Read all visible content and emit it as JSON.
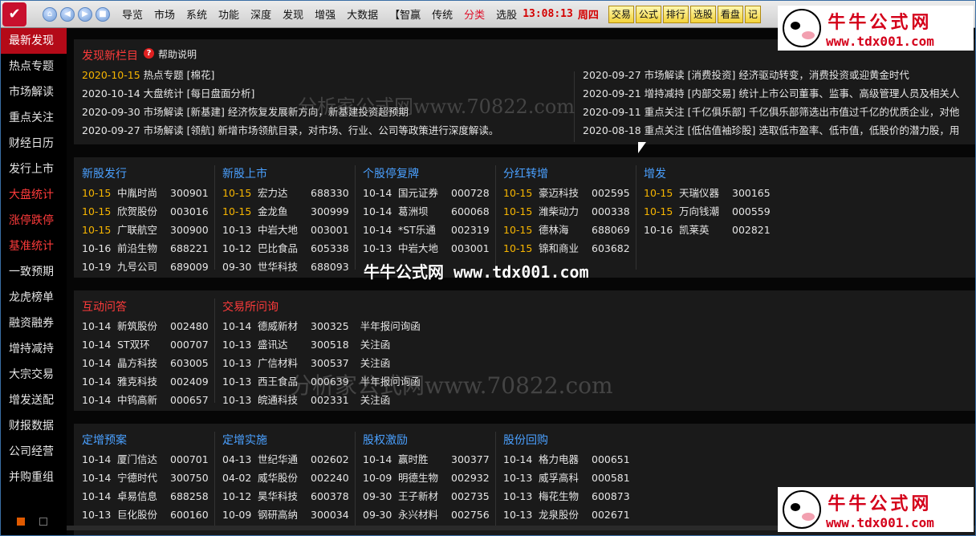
{
  "topbar": {
    "nav_icons": [
      "home-icon",
      "back-icon",
      "forward-icon",
      "stop-icon"
    ],
    "menus": [
      {
        "label": "导览",
        "red": false
      },
      {
        "label": "市场",
        "red": false
      },
      {
        "label": "系统",
        "red": false
      },
      {
        "label": "功能",
        "red": false
      },
      {
        "label": "深度",
        "red": false
      },
      {
        "label": "发现",
        "red": false
      },
      {
        "label": "增强",
        "red": false
      },
      {
        "label": "大数据",
        "red": false
      },
      {
        "label": "【智赢",
        "red": false
      },
      {
        "label": "传统",
        "red": false
      },
      {
        "label": "分类",
        "red": true
      },
      {
        "label": "选股",
        "red": false
      }
    ],
    "clock": "13:08:13",
    "weekday": "周四",
    "tool_buttons": [
      "交易",
      "公式",
      "排行",
      "选股",
      "看盘",
      "记"
    ]
  },
  "sidebar": {
    "items": [
      {
        "label": "最新发现",
        "state": "active"
      },
      {
        "label": "热点专题",
        "state": ""
      },
      {
        "label": "市场解读",
        "state": ""
      },
      {
        "label": "重点关注",
        "state": ""
      },
      {
        "label": "财经日历",
        "state": ""
      },
      {
        "label": "发行上市",
        "state": ""
      },
      {
        "label": "大盘统计",
        "state": "red"
      },
      {
        "label": "涨停跌停",
        "state": "red"
      },
      {
        "label": "基准统计",
        "state": "red"
      },
      {
        "label": "一致预期",
        "state": ""
      },
      {
        "label": "龙虎榜单",
        "state": ""
      },
      {
        "label": "融资融券",
        "state": ""
      },
      {
        "label": "增持减持",
        "state": ""
      },
      {
        "label": "大宗交易",
        "state": ""
      },
      {
        "label": "增发送配",
        "state": ""
      },
      {
        "label": "财报数据",
        "state": ""
      },
      {
        "label": "公司经营",
        "state": ""
      },
      {
        "label": "并购重组",
        "state": ""
      }
    ]
  },
  "discover": {
    "title": "发现新栏目",
    "help": "帮助说明",
    "left": [
      {
        "hl": "2020-10-15",
        "text": " 热点专题 [棉花]"
      },
      {
        "hl": "",
        "text": "2020-10-14 大盘统计 [每日盘面分析]"
      },
      {
        "hl": "",
        "text": "2020-09-30 市场解读 [新基建] 经济恢复发展新方向，新基建投资超预期"
      },
      {
        "hl": "",
        "text": "2020-09-27 市场解读 [领航] 新增市场领航目录，对市场、行业、公司等政策进行深度解读。"
      }
    ],
    "right": [
      "2020-09-27 市场解读 [消费投资] 经济驱动转变，消费投资或迎黄金时代",
      "2020-09-21 增持减持 [内部交易] 统计上市公司董事、监事、高级管理人员及相关人",
      "2020-09-11 重点关注 [千亿俱乐部] 千亿俱乐部筛选出市值过千亿的优质企业，对他",
      "2020-08-18 重点关注 [低估值袖珍股] 选取低市盈率、低市值，低股价的潜力股，用"
    ]
  },
  "panel2": [
    {
      "title": "新股发行",
      "red": false,
      "rows": [
        {
          "d": "10-15",
          "y": true,
          "n": "中胤时尚",
          "c": "300901"
        },
        {
          "d": "10-15",
          "y": true,
          "n": "欣贺股份",
          "c": "003016"
        },
        {
          "d": "10-15",
          "y": true,
          "n": "广联航空",
          "c": "300900"
        },
        {
          "d": "10-16",
          "y": false,
          "n": "前沿生物",
          "c": "688221"
        },
        {
          "d": "10-19",
          "y": false,
          "n": "九号公司",
          "c": "689009"
        }
      ]
    },
    {
      "title": "新股上市",
      "red": false,
      "rows": [
        {
          "d": "10-15",
          "y": true,
          "n": "宏力达",
          "c": "688330"
        },
        {
          "d": "10-15",
          "y": true,
          "n": "金龙鱼",
          "c": "300999"
        },
        {
          "d": "10-13",
          "y": false,
          "n": "中岩大地",
          "c": "003001"
        },
        {
          "d": "10-12",
          "y": false,
          "n": "巴比食品",
          "c": "605338"
        },
        {
          "d": "09-30",
          "y": false,
          "n": "世华科技",
          "c": "688093"
        }
      ]
    },
    {
      "title": "个股停复牌",
      "red": false,
      "rows": [
        {
          "d": "10-14",
          "y": false,
          "n": "国元证券",
          "c": "000728"
        },
        {
          "d": "10-14",
          "y": false,
          "n": "葛洲坝",
          "c": "600068"
        },
        {
          "d": "10-14",
          "y": false,
          "n": "*ST乐通",
          "c": "002319"
        },
        {
          "d": "10-13",
          "y": false,
          "n": "中岩大地",
          "c": "003001"
        }
      ]
    },
    {
      "title": "分红转增",
      "red": false,
      "rows": [
        {
          "d": "10-15",
          "y": true,
          "n": "豪迈科技",
          "c": "002595"
        },
        {
          "d": "10-15",
          "y": true,
          "n": "潍柴动力",
          "c": "000338"
        },
        {
          "d": "10-15",
          "y": true,
          "n": "德林海",
          "c": "688069"
        },
        {
          "d": "10-15",
          "y": true,
          "n": "锦和商业",
          "c": "603682"
        }
      ]
    },
    {
      "title": "增发",
      "red": false,
      "rows": [
        {
          "d": "10-15",
          "y": true,
          "n": "天瑞仪器",
          "c": "300165"
        },
        {
          "d": "10-15",
          "y": true,
          "n": "万向钱潮",
          "c": "000559"
        },
        {
          "d": "10-16",
          "y": false,
          "n": "凯莱英",
          "c": "002821"
        }
      ]
    }
  ],
  "panel3": [
    {
      "title": "互动问答",
      "red": true,
      "rows": [
        {
          "d": "10-14",
          "y": false,
          "n": "新筑股份",
          "c": "002480",
          "x": ""
        },
        {
          "d": "10-14",
          "y": false,
          "n": "ST双环",
          "c": "000707",
          "x": ""
        },
        {
          "d": "10-14",
          "y": false,
          "n": "晶方科技",
          "c": "603005",
          "x": ""
        },
        {
          "d": "10-14",
          "y": false,
          "n": "雅克科技",
          "c": "002409",
          "x": ""
        },
        {
          "d": "10-14",
          "y": false,
          "n": "中钨高新",
          "c": "000657",
          "x": ""
        }
      ]
    },
    {
      "title": "交易所问询",
      "red": true,
      "rows": [
        {
          "d": "10-14",
          "y": false,
          "n": "德威新材",
          "c": "300325",
          "x": "半年报问询函"
        },
        {
          "d": "10-13",
          "y": false,
          "n": "盛讯达",
          "c": "300518",
          "x": "关注函"
        },
        {
          "d": "10-13",
          "y": false,
          "n": "广信材料",
          "c": "300537",
          "x": "关注函"
        },
        {
          "d": "10-13",
          "y": false,
          "n": "西王食品",
          "c": "000639",
          "x": "半年报问询函"
        },
        {
          "d": "10-13",
          "y": false,
          "n": "皖通科技",
          "c": "002331",
          "x": "关注函"
        }
      ]
    }
  ],
  "panel4": [
    {
      "title": "定增预案",
      "red": false,
      "rows": [
        {
          "d": "10-14",
          "y": false,
          "n": "厦门信达",
          "c": "000701"
        },
        {
          "d": "10-14",
          "y": false,
          "n": "宁德时代",
          "c": "300750"
        },
        {
          "d": "10-14",
          "y": false,
          "n": "卓易信息",
          "c": "688258"
        },
        {
          "d": "10-13",
          "y": false,
          "n": "巨化股份",
          "c": "600160"
        }
      ]
    },
    {
      "title": "定增实施",
      "red": false,
      "rows": [
        {
          "d": "04-13",
          "y": false,
          "n": "世纪华通",
          "c": "002602"
        },
        {
          "d": "04-02",
          "y": false,
          "n": "威华股份",
          "c": "002240"
        },
        {
          "d": "10-12",
          "y": false,
          "n": "昊华科技",
          "c": "600378"
        },
        {
          "d": "10-09",
          "y": false,
          "n": "钢研高纳",
          "c": "300034"
        }
      ]
    },
    {
      "title": "股权激励",
      "red": false,
      "rows": [
        {
          "d": "10-14",
          "y": false,
          "n": "赢时胜",
          "c": "300377"
        },
        {
          "d": "10-09",
          "y": false,
          "n": "明德生物",
          "c": "002932"
        },
        {
          "d": "09-30",
          "y": false,
          "n": "王子新材",
          "c": "002735"
        },
        {
          "d": "09-30",
          "y": false,
          "n": "永兴材料",
          "c": "002756"
        }
      ]
    },
    {
      "title": "股份回购",
      "red": false,
      "rows": [
        {
          "d": "10-14",
          "y": false,
          "n": "格力电器",
          "c": "000651"
        },
        {
          "d": "10-13",
          "y": false,
          "n": "威孚高科",
          "c": "000581"
        },
        {
          "d": "10-13",
          "y": false,
          "n": "梅花生物",
          "c": "600873"
        },
        {
          "d": "10-13",
          "y": false,
          "n": "龙泉股份",
          "c": "002671"
        }
      ]
    }
  ],
  "watermarks": {
    "site_a": "分析家公式网www.70822.com",
    "site_b": "牛牛公式网 www.tdx001.com",
    "badge_title": "牛牛公式网",
    "badge_url": "www.tdx001.com"
  }
}
